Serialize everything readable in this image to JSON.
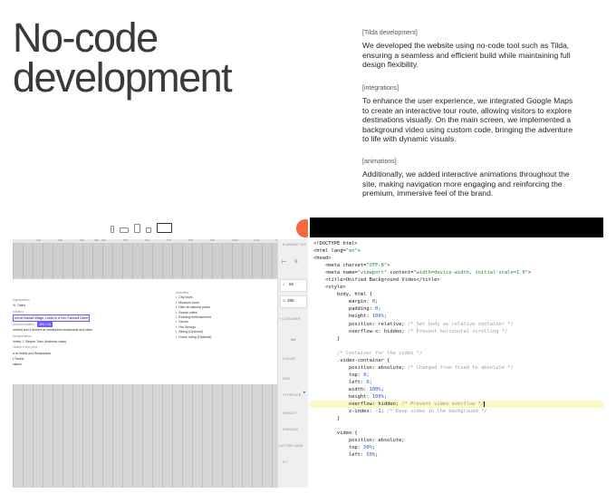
{
  "hero": {
    "title": "No-code development"
  },
  "sections": [
    {
      "tag": "[Tilda development]",
      "body": "We developed the website using no-code tool such as Tilda, ensuring a seamless and efficient build while maintaining full design flexibility."
    },
    {
      "tag": "[integrations]",
      "body": "To enhance the user experience, we integrated Google Maps to create an interactive tour route, allowing visitors to explore destinations visually. On the main screen, we implemented a background video using custom code, bringing the adventure to life with dynamic visuals."
    },
    {
      "tag": "[animations]",
      "body": "Additionally, we added interactive animations throughout the site, making navigation more engaging and reinforcing the premium, immersive feel of the brand."
    }
  ],
  "builder": {
    "ruler": [
      "100",
      "200",
      "300",
      "400",
      "500",
      "600",
      "700",
      "800",
      "900",
      "1000",
      "1100",
      "1200"
    ],
    "ruler_active": "440",
    "left_lines": [
      {
        "text": "organization",
        "kind": "lbl"
      },
      {
        "text": "%, Trains",
        "kind": ""
      },
      {
        "text": "nutrition",
        "kind": "lbl"
      },
      {
        "text": "ech at Nomad Village, Lunch in a Yurt, Farewell Dinne",
        "kind": "hl"
      },
      {
        "text": "accommodation",
        "kind": "lbl",
        "pill": "386 x 24"
      },
      {
        "text": "unches and 3 dinners at handpicked restaurants and cafes",
        "kind": ""
      },
      {
        "text": "transportation",
        "kind": "lbl"
      },
      {
        "text": "hotels, 1 Sleeper Train (business class)",
        "kind": ""
      },
      {
        "text": "cluded in the price",
        "kind": "lbl"
      },
      {
        "text": "d at Hotels and Restaurants",
        "kind": ""
      },
      {
        "text": "t Tickets",
        "kind": ""
      },
      {
        "text": "ctance",
        "kind": ""
      }
    ],
    "right_label": "Activities",
    "right_items": [
      "City tours",
      "Museum tours",
      "Hike at national parks",
      "Scenic cafes",
      "Evening entertainment",
      "Sauna",
      "Hot Springs",
      "Skiing (Optional)",
      "Horse riding (Optional)"
    ],
    "panel": {
      "header": "ELEMENT SIZ",
      "x_label": "X",
      "x_value": "66",
      "w_label": "W",
      "w_value": "386",
      "container": "+ CONTAINER",
      "align": "left",
      "color": "COLOR",
      "size": "SIZE",
      "typeface": "TYPEFACE",
      "weight": "WEIGHT",
      "spacing": "SPACING",
      "letter_case": "LETTER CASE",
      "fit": "FIT"
    }
  },
  "code_lines": [
    "<!DOCTYPE html>",
    "<html lang=\"en\">",
    "<head>",
    "    <meta charset=\"UTF-8\">",
    "    <meta name=\"viewport\" content=\"width=device-width, initial-scale=1.0\">",
    "    <title>Unified Background Video</title>",
    "    <style>",
    "        body, html {",
    "            margin: 0;",
    "            padding: 0;",
    "            height: 100%;",
    "            position: relative; /* Set body as relative container */",
    "            overflow-x: hidden; /* Prevent horizontal scrolling */",
    "        }",
    "",
    "        /* Container for the video */",
    "        .video-container {",
    "            position: absolute; /* Changed from fixed to absolute */",
    "            top: 0;",
    "            left: 0;",
    "            width: 100%;",
    "            height: 100%;",
    "            overflow: hidden; /* Prevent video overflow */",
    "            z-index: -1; /* Keep video in the background */",
    "        }",
    "",
    "        video {",
    "            position: absolute;",
    "            top: 50%;",
    "            left: 50%;"
  ],
  "code_highlight_line": 22
}
